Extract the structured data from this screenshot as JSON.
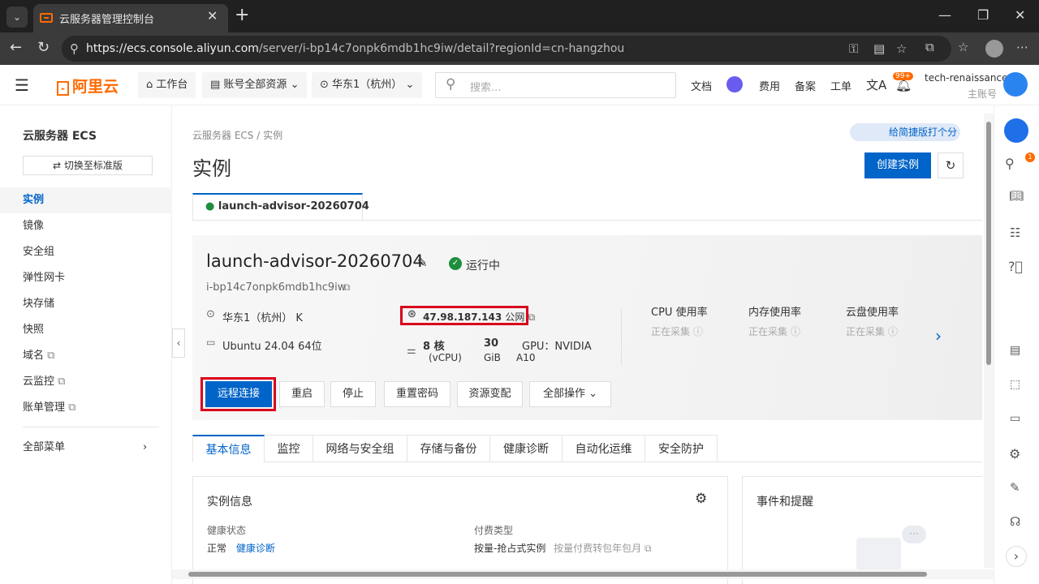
{
  "browser": {
    "tab_title": "云服务器管理控制台",
    "url_host": "https://ecs.console.aliyun.com",
    "url_path": "/server/i-bp14c7onpk6mdb1hc9iw/detail?regionId=cn-hangzhou"
  },
  "topnav": {
    "logo": "阿里云",
    "workbench": "工作台",
    "resources": "账号全部资源",
    "region": "华东1（杭州）",
    "search_placeholder": "搜索...",
    "links": [
      "文档",
      "费用",
      "备案",
      "工单"
    ],
    "badge": "99+",
    "account_name": "tech-renaissance",
    "account_role": "主账号"
  },
  "sidebar": {
    "title": "云服务器 ECS",
    "switch_btn": "切换至标准版",
    "items": [
      "实例",
      "镜像",
      "安全组",
      "弹性网卡",
      "块存储",
      "快照",
      "域名",
      "云监控",
      "账单管理"
    ],
    "all_menu": "全部菜单"
  },
  "main": {
    "breadcrumb_1": "云服务器 ECS",
    "breadcrumb_sep": "/",
    "breadcrumb_2": "实例",
    "title": "实例",
    "feedback": "给简捷版打个分",
    "create_btn": "创建实例",
    "instance_tab": "launch-advisor-20260704"
  },
  "instance": {
    "name": "launch-advisor-20260704",
    "status": "运行中",
    "id": "i-bp14c7onpk6mdb1hc9iw",
    "region": "华东1（杭州） K",
    "ip": "47.98.187.143",
    "ip_type": "公网",
    "os": "Ubuntu 24.04 64位",
    "cpu_num": "8 核",
    "cpu_unit": "(vCPU)",
    "mem_num": "30",
    "mem_unit": "GiB",
    "gpu_1": "GPU：NVIDIA",
    "gpu_2": "A10",
    "metrics": [
      {
        "label": "CPU 使用率",
        "value": "正在采集"
      },
      {
        "label": "内存使用率",
        "value": "正在采集"
      },
      {
        "label": "云盘使用率",
        "value": "正在采集"
      }
    ]
  },
  "actions": [
    "远程连接",
    "重启",
    "停止",
    "重置密码",
    "资源变配",
    "全部操作"
  ],
  "tabs": [
    "基本信息",
    "监控",
    "网络与安全组",
    "存储与备份",
    "健康诊断",
    "自动化运维",
    "安全防护"
  ],
  "info": {
    "title": "实例信息",
    "health_label": "健康状态",
    "health_value": "正常",
    "health_link": "健康诊断",
    "billing_label": "付费类型",
    "billing_value": "按量-抢占式实例",
    "billing_link": "按量付费转包年包月",
    "events_title": "事件和提醒"
  },
  "colors": {
    "primary": "#0064c8",
    "highlight": "#d9001b",
    "orange": "#ff6a00",
    "running": "#1e8e3e"
  }
}
